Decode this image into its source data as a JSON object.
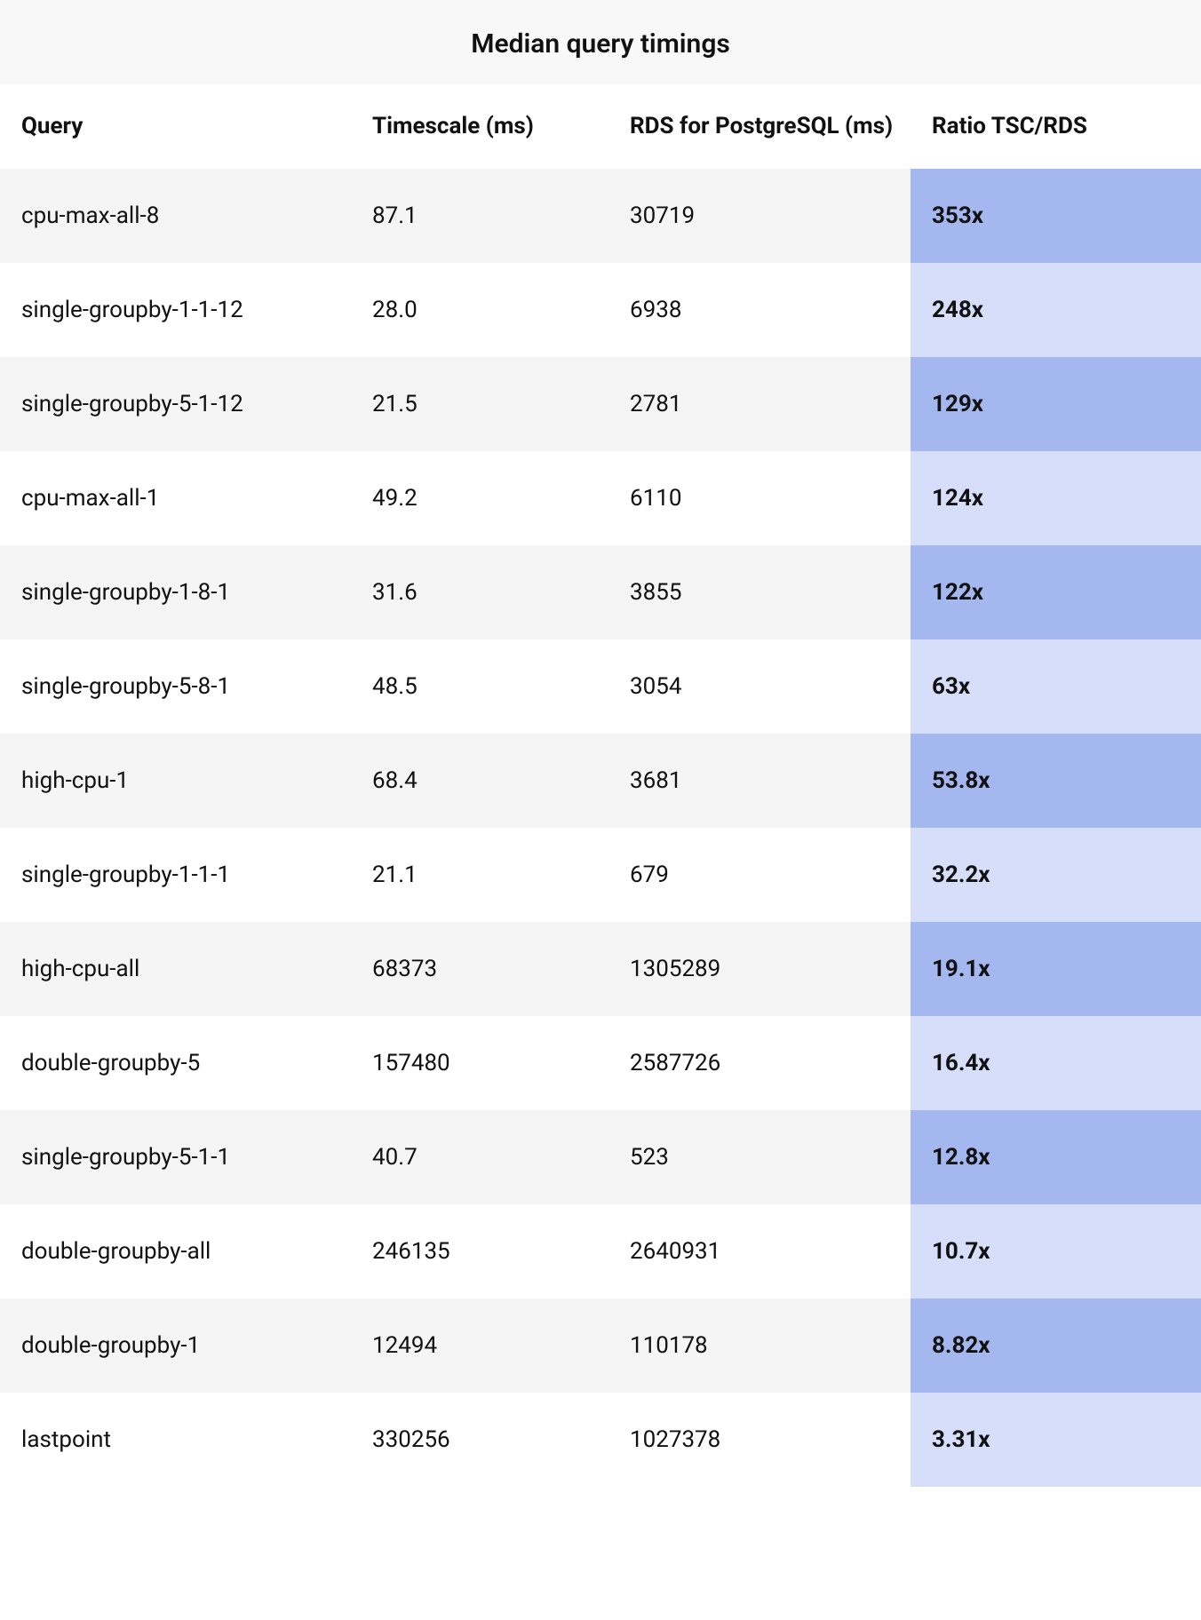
{
  "title": "Median query timings",
  "columns": {
    "query": "Query",
    "timescale": "Timescale (ms)",
    "rds": "RDS for PostgreSQL (ms)",
    "ratio": "Ratio TSC/RDS"
  },
  "rows": [
    {
      "query": "cpu-max-all-8",
      "timescale": "87.1",
      "rds": "30719",
      "ratio": "353x"
    },
    {
      "query": "single-groupby-1-1-12",
      "timescale": "28.0",
      "rds": "6938",
      "ratio": "248x"
    },
    {
      "query": "single-groupby-5-1-12",
      "timescale": "21.5",
      "rds": "2781",
      "ratio": "129x"
    },
    {
      "query": "cpu-max-all-1",
      "timescale": "49.2",
      "rds": "6110",
      "ratio": "124x"
    },
    {
      "query": "single-groupby-1-8-1",
      "timescale": "31.6",
      "rds": "3855",
      "ratio": "122x"
    },
    {
      "query": "single-groupby-5-8-1",
      "timescale": "48.5",
      "rds": "3054",
      "ratio": "63x"
    },
    {
      "query": "high-cpu-1",
      "timescale": "68.4",
      "rds": "3681",
      "ratio": "53.8x"
    },
    {
      "query": "single-groupby-1-1-1",
      "timescale": "21.1",
      "rds": "679",
      "ratio": "32.2x"
    },
    {
      "query": "high-cpu-all",
      "timescale": "68373",
      "rds": "1305289",
      "ratio": "19.1x"
    },
    {
      "query": "double-groupby-5",
      "timescale": "157480",
      "rds": "2587726",
      "ratio": "16.4x"
    },
    {
      "query": "single-groupby-5-1-1",
      "timescale": "40.7",
      "rds": "523",
      "ratio": "12.8x"
    },
    {
      "query": "double-groupby-all",
      "timescale": "246135",
      "rds": "2640931",
      "ratio": "10.7x"
    },
    {
      "query": "double-groupby-1",
      "timescale": "12494",
      "rds": "110178",
      "ratio": "8.82x"
    },
    {
      "query": "lastpoint",
      "timescale": "330256",
      "rds": "1027378",
      "ratio": "3.31x"
    }
  ],
  "chart_data": {
    "type": "table",
    "title": "Median query timings",
    "columns": [
      "Query",
      "Timescale (ms)",
      "RDS for PostgreSQL (ms)",
      "Ratio TSC/RDS"
    ],
    "series": [
      {
        "name": "Timescale (ms)",
        "categories": [
          "cpu-max-all-8",
          "single-groupby-1-1-12",
          "single-groupby-5-1-12",
          "cpu-max-all-1",
          "single-groupby-1-8-1",
          "single-groupby-5-8-1",
          "high-cpu-1",
          "single-groupby-1-1-1",
          "high-cpu-all",
          "double-groupby-5",
          "single-groupby-5-1-1",
          "double-groupby-all",
          "double-groupby-1",
          "lastpoint"
        ],
        "values": [
          87.1,
          28.0,
          21.5,
          49.2,
          31.6,
          48.5,
          68.4,
          21.1,
          68373,
          157480,
          40.7,
          246135,
          12494,
          330256
        ]
      },
      {
        "name": "RDS for PostgreSQL (ms)",
        "categories": [
          "cpu-max-all-8",
          "single-groupby-1-1-12",
          "single-groupby-5-1-12",
          "cpu-max-all-1",
          "single-groupby-1-8-1",
          "single-groupby-5-8-1",
          "high-cpu-1",
          "single-groupby-1-1-1",
          "high-cpu-all",
          "double-groupby-5",
          "single-groupby-5-1-1",
          "double-groupby-all",
          "double-groupby-1",
          "lastpoint"
        ],
        "values": [
          30719,
          6938,
          2781,
          6110,
          3855,
          3054,
          3681,
          679,
          1305289,
          2587726,
          523,
          2640931,
          110178,
          1027378
        ]
      },
      {
        "name": "Ratio TSC/RDS",
        "categories": [
          "cpu-max-all-8",
          "single-groupby-1-1-12",
          "single-groupby-5-1-12",
          "cpu-max-all-1",
          "single-groupby-1-8-1",
          "single-groupby-5-8-1",
          "high-cpu-1",
          "single-groupby-1-1-1",
          "high-cpu-all",
          "double-groupby-5",
          "single-groupby-5-1-1",
          "double-groupby-all",
          "double-groupby-1",
          "lastpoint"
        ],
        "values": [
          353,
          248,
          129,
          124,
          122,
          63,
          53.8,
          32.2,
          19.1,
          16.4,
          12.8,
          10.7,
          8.82,
          3.31
        ]
      }
    ]
  }
}
